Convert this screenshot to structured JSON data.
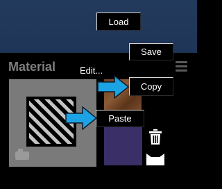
{
  "panel": {
    "title": "Material"
  },
  "context_menu": {
    "edit_label": "Edit...",
    "load_label": "Load",
    "save_label": "Save",
    "copy_label": "Copy",
    "paste_label": "Paste"
  },
  "icons": {
    "menu": "hamburger-icon",
    "delete": "trash-icon",
    "tray": "tray-icon",
    "preview_corner": "folder-icon",
    "pointer": "arrow-icon"
  },
  "colors": {
    "background": "#000000",
    "top_band": "#203659",
    "arrow": "#1ca3e4",
    "swatch": "#3a2f66",
    "preview_bg": "#7a7a7a"
  }
}
